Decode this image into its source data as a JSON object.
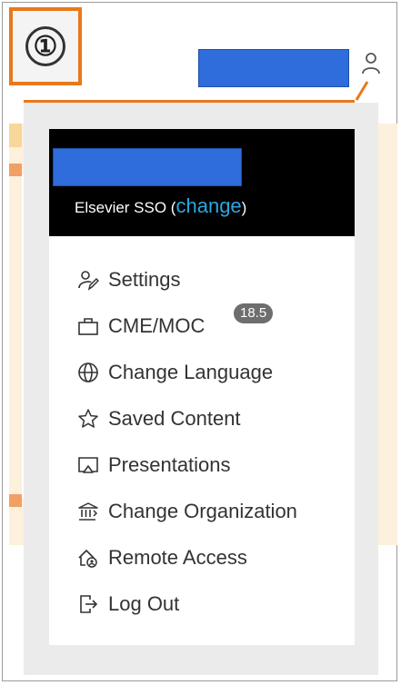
{
  "step_marker": "①",
  "header": {
    "sso_prefix": "Elsevier SSO (",
    "sso_link": "change",
    "sso_suffix": ")"
  },
  "menu": [
    {
      "label": "Settings",
      "icon": "settings-user-icon"
    },
    {
      "label": "CME/MOC",
      "icon": "briefcase-icon",
      "badge": "18.5"
    },
    {
      "label": "Change Language",
      "icon": "globe-icon"
    },
    {
      "label": "Saved Content",
      "icon": "star-icon"
    },
    {
      "label": "Presentations",
      "icon": "presentation-icon"
    },
    {
      "label": "Change Organization",
      "icon": "institution-icon"
    },
    {
      "label": "Remote Access",
      "icon": "remote-home-icon"
    },
    {
      "label": "Log Out",
      "icon": "logout-icon"
    }
  ],
  "colors": {
    "accent": "#e8791a",
    "redaction": "#2f6ddc",
    "link": "#29a8e0",
    "badge": "#6e6e6e"
  }
}
